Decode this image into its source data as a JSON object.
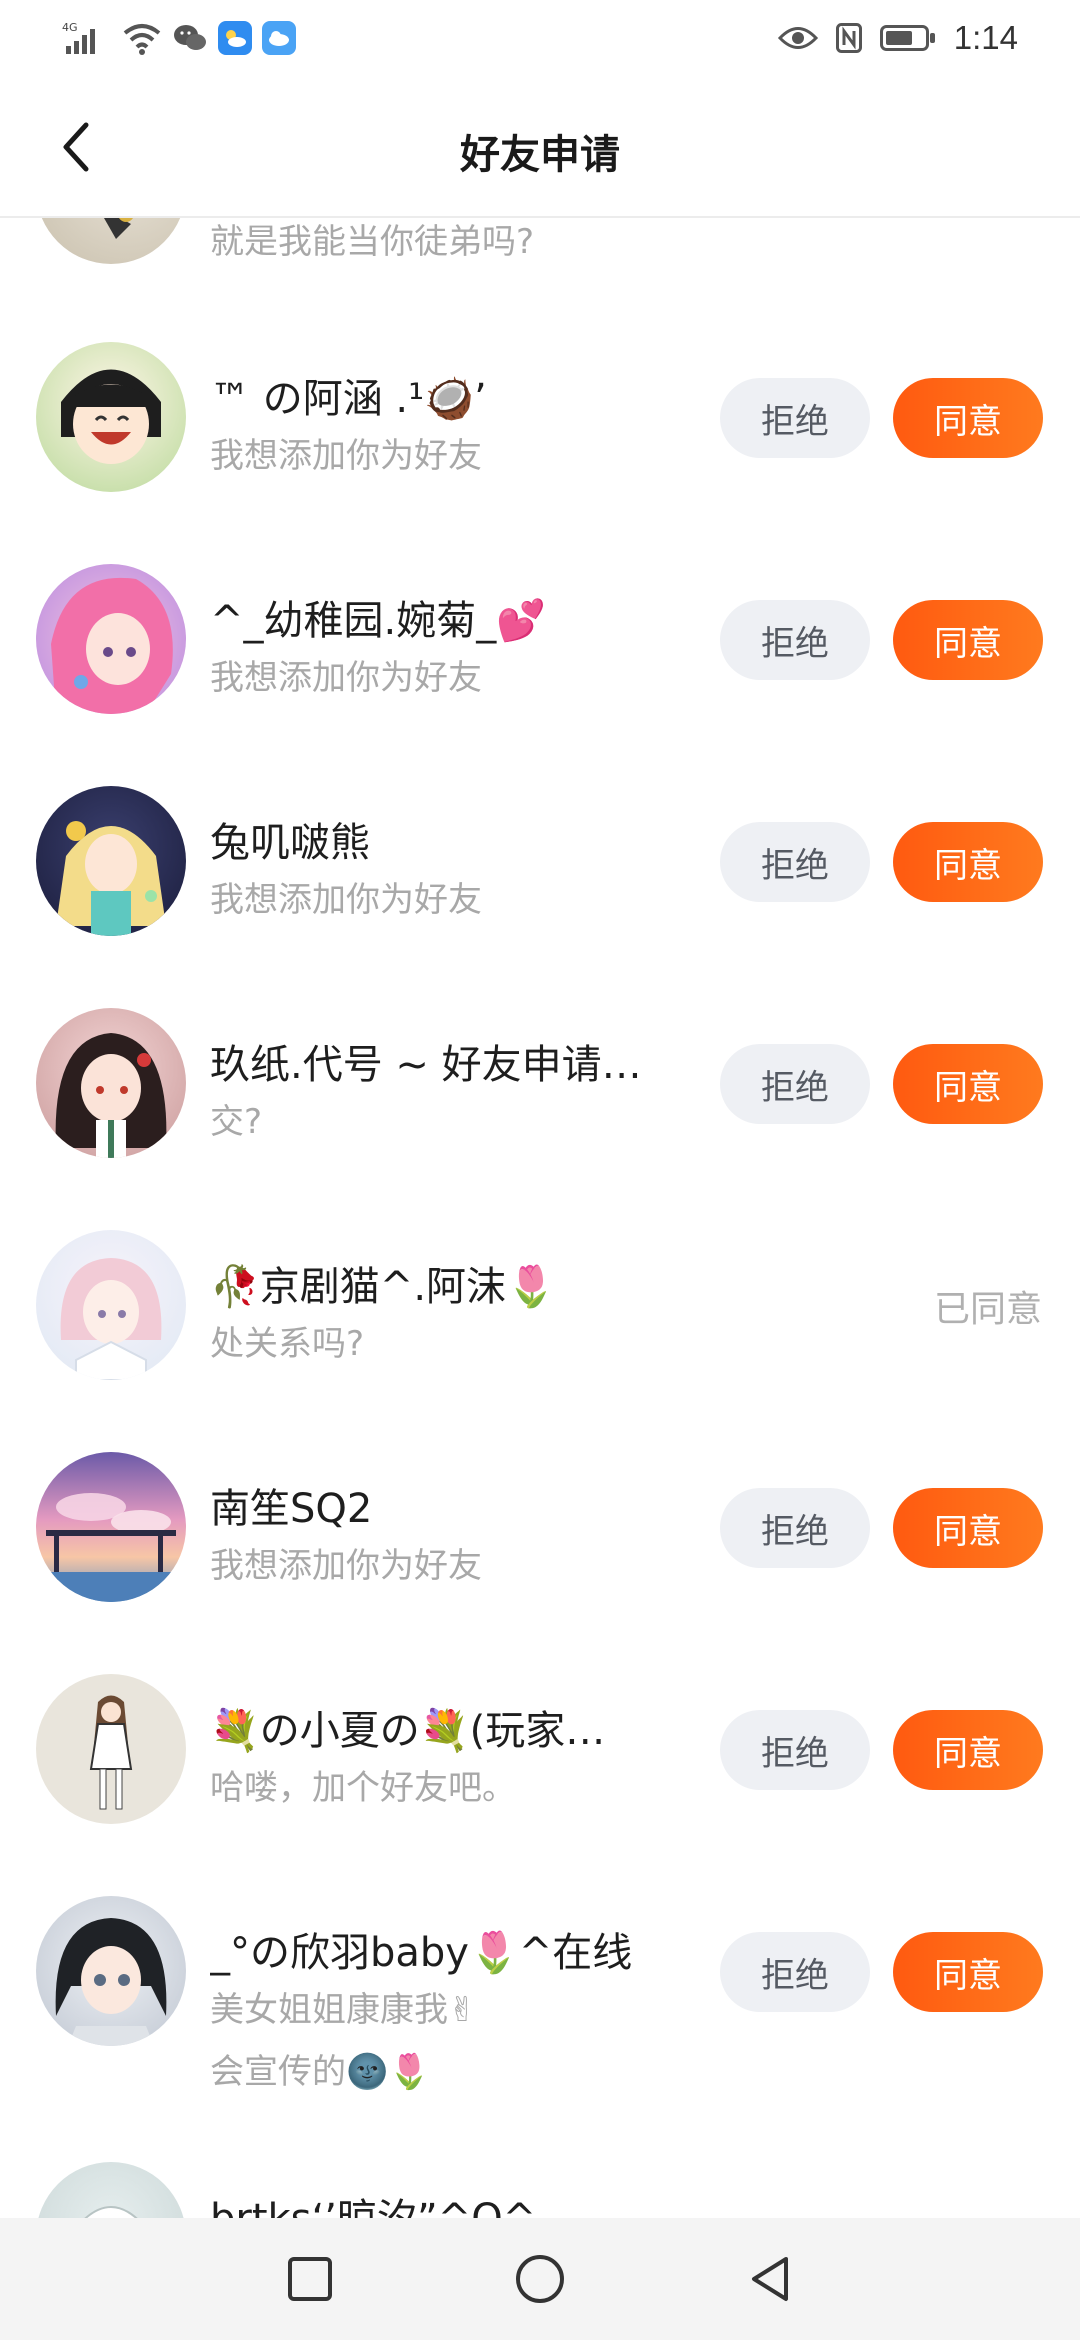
{
  "status_bar": {
    "network": "4G",
    "time": "1:14",
    "icons": [
      "signal-icon",
      "wifi-icon",
      "wechat-icon",
      "weather-app-icon",
      "cloud-app-icon",
      "eye-icon",
      "nfc-icon",
      "battery-icon"
    ]
  },
  "header": {
    "title": "好友申请",
    "back_icon": "chevron-left-icon"
  },
  "requests": [
    {
      "name": "",
      "message": "就是我能当你徒弟吗?",
      "status": "partial"
    },
    {
      "name": "™ の阿涵 .¹🥥’",
      "message": "我想添加你为好友",
      "reject_label": "拒绝",
      "accept_label": "同意"
    },
    {
      "name": "^_幼稚园.婉菊_💕",
      "message": "我想添加你为好友",
      "reject_label": "拒绝",
      "accept_label": "同意"
    },
    {
      "name": "兔叽啵熊",
      "message": "我想添加你为好友",
      "reject_label": "拒绝",
      "accept_label": "同意"
    },
    {
      "name": "玖纸.代号 ~ 好友申请…",
      "message": "交?",
      "reject_label": "拒绝",
      "accept_label": "同意"
    },
    {
      "name": "🥀京剧猫^.阿沫🌷",
      "message": "处关系吗?",
      "status_label": "已同意"
    },
    {
      "name": "南笙SQ2",
      "message": "我想添加你为好友",
      "reject_label": "拒绝",
      "accept_label": "同意"
    },
    {
      "name": "💐の小夏の💐(玩家…",
      "message": "哈喽，加个好友吧。",
      "reject_label": "拒绝",
      "accept_label": "同意"
    },
    {
      "name": "_°の欣羽baby🌷^在线",
      "message": "美女姐姐康康我✌",
      "message2": "会宣传的🌚🌷",
      "reject_label": "拒绝",
      "accept_label": "同意"
    },
    {
      "name": "brtks‘’晾汐”^O^",
      "message": ""
    }
  ],
  "nav_bar": {
    "recent_icon": "square-recent-apps-icon",
    "home_icon": "circle-home-icon",
    "back_icon": "triangle-back-icon"
  },
  "colors": {
    "accent": "#ff6a14",
    "reject_bg": "#eef0f4",
    "secondary_text": "#a8a8a8"
  }
}
